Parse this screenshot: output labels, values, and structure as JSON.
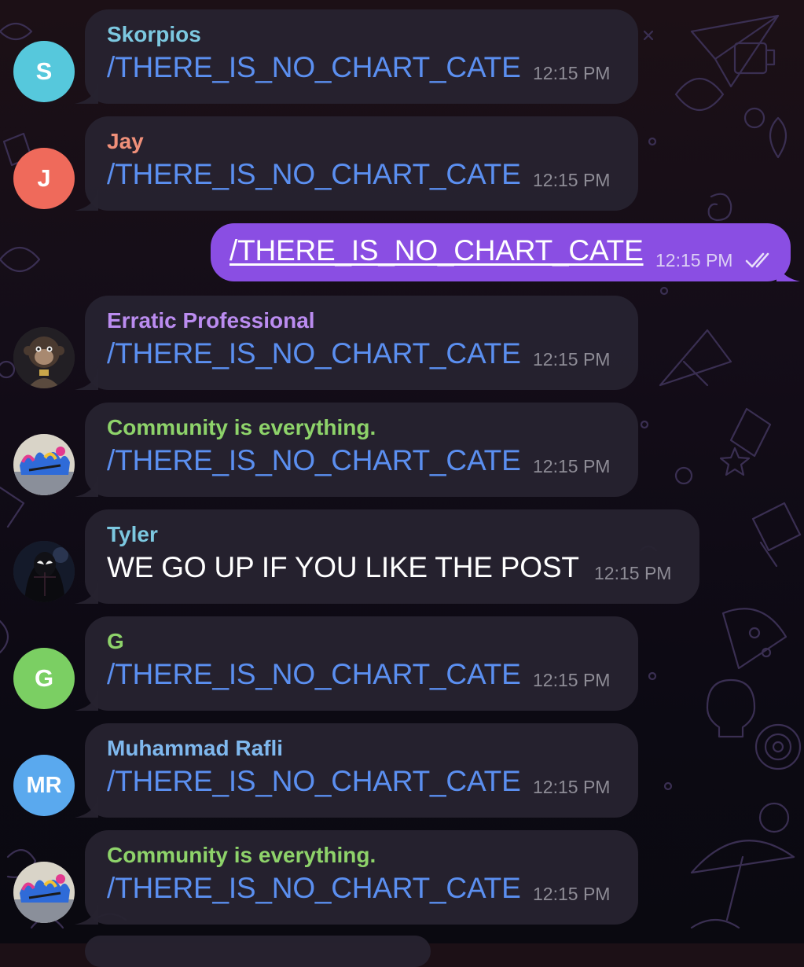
{
  "chat": {
    "messages": [
      {
        "sender": "Skorpios",
        "sender_color": "#7cc8e0",
        "avatar_initials": "S",
        "avatar_color": "#56c8dc",
        "text": "/THERE_IS_NO_CHART_CATE",
        "time": "12:15 PM"
      },
      {
        "sender": "Jay",
        "sender_color": "#f0907a",
        "avatar_initials": "J",
        "avatar_color": "#ef6a5b",
        "text": "/THERE_IS_NO_CHART_CATE",
        "time": "12:15 PM"
      },
      {
        "sender": "Erratic Professional",
        "sender_color": "#bb8cf0",
        "avatar_image": "monkey-photo",
        "text": "/THERE_IS_NO_CHART_CATE",
        "time": "12:15 PM"
      },
      {
        "sender": "Community is everything.",
        "sender_color": "#8ed36a",
        "avatar_image": "graffiti-photo",
        "text": "/THERE_IS_NO_CHART_CATE",
        "time": "12:15 PM"
      },
      {
        "sender": "Tyler",
        "sender_color": "#7cc8e0",
        "avatar_image": "spider-photo",
        "text": "WE GO UP IF YOU LIKE THE POST",
        "time": "12:15 PM"
      },
      {
        "sender": "G",
        "sender_color": "#8ed36a",
        "avatar_initials": "G",
        "avatar_color": "#7bcf63",
        "text": "/THERE_IS_NO_CHART_CATE",
        "time": "12:15 PM"
      },
      {
        "sender": "Muhammad Rafli",
        "sender_color": "#7fb8ee",
        "avatar_initials": "MR",
        "avatar_color": "#5aa9ee",
        "text": "/THERE_IS_NO_CHART_CATE",
        "time": "12:15 PM"
      },
      {
        "sender": "Community is everything.",
        "sender_color": "#8ed36a",
        "avatar_image": "graffiti-photo",
        "text": "/THERE_IS_NO_CHART_CATE",
        "time": "12:15 PM"
      }
    ],
    "outgoing": {
      "text": "/THERE_IS_NO_CHART_CATE",
      "time": "12:15 PM",
      "status_icon": "double-check-icon",
      "bubble_color": "#8a4ee3"
    },
    "link_color": "#5b8ff0",
    "bubble_color": "#262230"
  }
}
